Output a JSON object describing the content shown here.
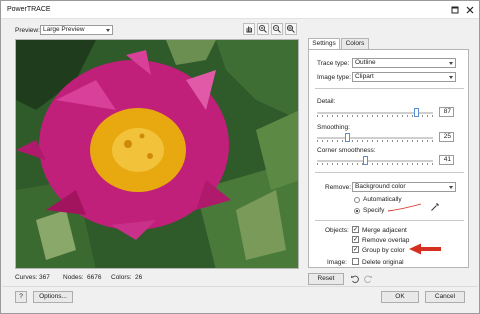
{
  "window": {
    "title": "PowerTRACE"
  },
  "titlebar_icons": {
    "restore": "restore-icon",
    "close": "close-icon"
  },
  "preview": {
    "label": "Preview:",
    "mode": "Large Preview"
  },
  "toolbar_icons": [
    "pan-hand-icon",
    "zoom-in-icon",
    "zoom-out-icon",
    "zoom-fit-icon"
  ],
  "tabs": [
    {
      "label": "Settings",
      "active": true
    },
    {
      "label": "Colors",
      "active": false
    }
  ],
  "settings": {
    "trace_type_label": "Trace type:",
    "trace_type": "Outline",
    "image_type_label": "Image type:",
    "image_type": "Clipart",
    "detail_label": "Detail:",
    "detail_value": "87",
    "smoothing_label": "Smoothing:",
    "smoothing_value": "25",
    "corner_label": "Corner smoothness:",
    "corner_value": "41",
    "remove_label": "Remove:",
    "remove_value": "Background color",
    "remove_options": [
      {
        "label": "Automatically",
        "selected": false
      },
      {
        "label": "Specify",
        "selected": true
      }
    ],
    "objects_label": "Objects:",
    "objects_options": [
      {
        "label": "Merge adjacent",
        "checked": true
      },
      {
        "label": "Remove overlap",
        "checked": true
      },
      {
        "label": "Group by color",
        "checked": true
      }
    ],
    "image_label": "Image:",
    "delete_original": {
      "label": "Delete original",
      "checked": false
    }
  },
  "slider_levels": {
    "detail": 0.87,
    "smoothing": 0.25,
    "corner": 0.41
  },
  "status": {
    "curves_label": "Curves:",
    "curves": "367",
    "nodes_label": "Nodes:",
    "nodes": "6676",
    "colors_label": "Colors:",
    "colors": "26"
  },
  "buttons": {
    "reset": "Reset",
    "help": "?",
    "options": "Options...",
    "ok": "OK",
    "cancel": "Cancel"
  },
  "colors": {
    "annotation_red": "#d62f1f",
    "flower_magenta": "#c01f7a",
    "flower_center": "#e8a810",
    "foliage": "#2f5a2a"
  }
}
